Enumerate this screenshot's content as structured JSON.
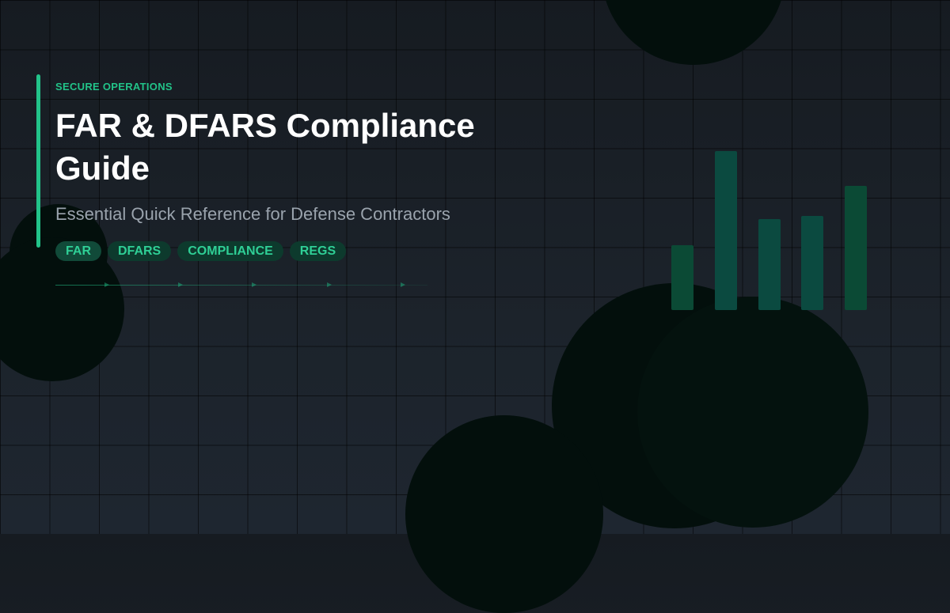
{
  "header": {
    "eyebrow": "SECURE OPERATIONS",
    "title": "FAR & DFARS Compliance Guide",
    "subtitle": "Essential Quick Reference for Defense Contractors"
  },
  "tags": [
    "FAR",
    "DFARS",
    "COMPLIANCE",
    "REGS"
  ],
  "decor_bars": {
    "levels": [
      0.41,
      1.0,
      0.57,
      0.59,
      0.78
    ],
    "colors": [
      "#0b4a35",
      "#0b4a40",
      "#0b4a40",
      "#0b4a40",
      "#0b4a35"
    ]
  },
  "colors": {
    "accent": "#22c389",
    "background": "#161b21",
    "title": "#ffffff",
    "subtitle": "#9aa3ad",
    "tag_background": "#0d3a2d"
  }
}
